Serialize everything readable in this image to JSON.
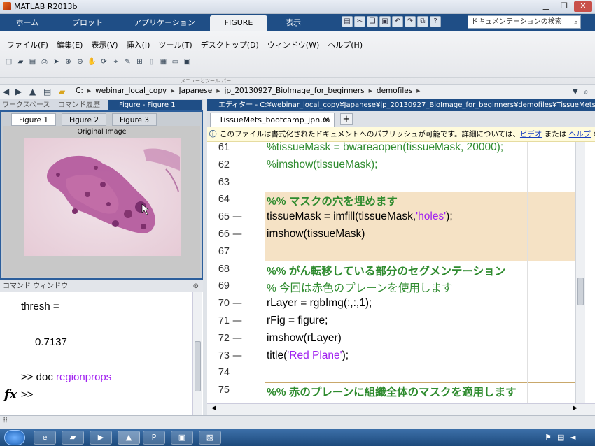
{
  "window": {
    "title": "MATLAB R2013b"
  },
  "ribbon": {
    "tabs": [
      {
        "label": "ホーム"
      },
      {
        "label": "プロット"
      },
      {
        "label": "アプリケーション"
      },
      {
        "label": "FIGURE"
      },
      {
        "label": "表示"
      }
    ],
    "search_placeholder": "ドキュメンテーションの検索"
  },
  "menu": {
    "items": [
      "ファイル(F)",
      "編集(E)",
      "表示(V)",
      "挿入(I)",
      "ツール(T)",
      "デスクトップ(D)",
      "ウィンドウ(W)",
      "ヘルプ(H)"
    ],
    "section_label": "メニューとツール バー"
  },
  "address": {
    "crumbs": [
      "C:",
      "webinar_local_copy",
      "Japanese",
      "jp_20130927_BioImage_for_beginners",
      "demofiles"
    ]
  },
  "left_tabs": [
    {
      "label": "ワークスペース"
    },
    {
      "label": "コマンド履歴"
    },
    {
      "label": "Figure - Figure 1"
    }
  ],
  "figure": {
    "tabs": [
      {
        "label": "Figure 1"
      },
      {
        "label": "Figure 2"
      },
      {
        "label": "Figure 3"
      }
    ],
    "image_title": "Original Image"
  },
  "command": {
    "header": "コマンド ウィンドウ",
    "lines": [
      {
        "text": "thresh ="
      },
      {
        "text": "0.7137"
      },
      {
        "prefix": ">> doc ",
        "keyword": "regionprops"
      },
      {
        "text": ">>"
      }
    ],
    "fx": "fx"
  },
  "editor": {
    "header": "エディター - C:¥webinar_local_copy¥Japanese¥jp_20130927_BioImage_for_beginners¥demofiles¥TissueMets_bootcamp_jpn.m",
    "tab": "TissueMets_bootcamp_jpn.m",
    "plus": "+",
    "info": {
      "text": "このファイルは書式化されたドキュメントへのパブリッシュが可能です。詳細については、",
      "link1": "ビデオ",
      "mid": " または ",
      "link2": "ヘルプ",
      "tail": " のパ"
    },
    "lines": [
      {
        "num": "61",
        "parts": [
          {
            "t": "%tissueMask = bwareaopen(tissueMask, 20000);",
            "c": "cm"
          }
        ]
      },
      {
        "num": "62",
        "parts": [
          {
            "t": "%imshow(tissueMask);",
            "c": "cm"
          }
        ]
      },
      {
        "num": "63",
        "parts": []
      },
      {
        "num": "64",
        "parts": [
          {
            "t": "%% マスクの穴を埋めます",
            "c": "cmb"
          }
        ]
      },
      {
        "num": "65",
        "dash": "—",
        "parts": [
          {
            "t": "tissueMask = imfill(tissueMask,",
            "c": ""
          },
          {
            "t": "'holes'",
            "c": "str"
          },
          {
            "t": ");",
            "c": ""
          }
        ]
      },
      {
        "num": "66",
        "dash": "—",
        "parts": [
          {
            "t": "imshow(tissueMask)",
            "c": ""
          }
        ]
      },
      {
        "num": "67",
        "parts": []
      },
      {
        "num": "68",
        "parts": [
          {
            "t": "%% がん転移している部分のセグメンテーション",
            "c": "cmb"
          }
        ]
      },
      {
        "num": "69",
        "parts": [
          {
            "t": "% 今回は赤色のプレーンを使用します",
            "c": "cm"
          }
        ]
      },
      {
        "num": "70",
        "dash": "—",
        "parts": [
          {
            "t": "rLayer = rgbImg(:,:,1);",
            "c": ""
          }
        ]
      },
      {
        "num": "71",
        "dash": "—",
        "parts": [
          {
            "t": "rFig = figure;",
            "c": ""
          }
        ]
      },
      {
        "num": "72",
        "dash": "—",
        "parts": [
          {
            "t": "imshow(rLayer)",
            "c": ""
          }
        ]
      },
      {
        "num": "73",
        "dash": "—",
        "parts": [
          {
            "t": "title(",
            "c": ""
          },
          {
            "t": "'Red Plane'",
            "c": "str"
          },
          {
            "t": ");",
            "c": ""
          }
        ]
      },
      {
        "num": "74",
        "parts": []
      },
      {
        "num": "75",
        "parts": [
          {
            "t": "%% 赤のプレーンに組織全体のマスクを適用します",
            "c": "cmb"
          }
        ]
      }
    ]
  },
  "colors": {
    "ribbon": "#1f4e86",
    "comment": "#2e8b2e",
    "string": "#a020f0",
    "cell": "#f5e2c5"
  }
}
